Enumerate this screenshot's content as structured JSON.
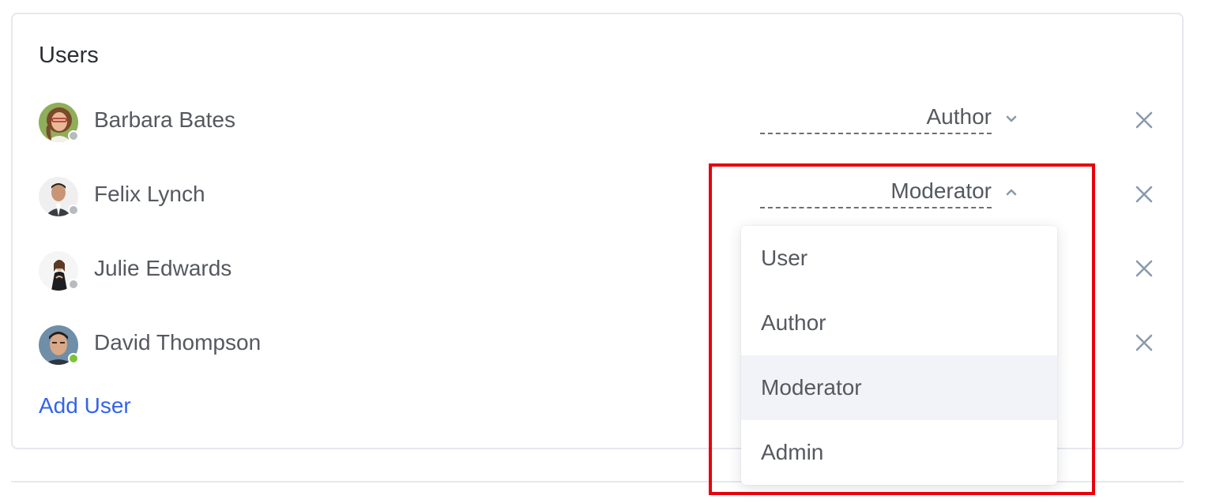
{
  "card": {
    "title": "Users"
  },
  "users": [
    {
      "name": "Barbara Bates",
      "role": "Author",
      "status": "offline",
      "dropdown_open": false
    },
    {
      "name": "Felix Lynch",
      "role": "Moderator",
      "status": "offline",
      "dropdown_open": true
    },
    {
      "name": "Julie Edwards",
      "role": "",
      "status": "offline",
      "dropdown_open": false
    },
    {
      "name": "David Thompson",
      "role": "",
      "status": "online",
      "dropdown_open": false
    }
  ],
  "icons": {
    "chevron_closed": "chevron-down-icon",
    "chevron_open": "chevron-up-icon",
    "remove": "close-icon"
  },
  "dropdown": {
    "options": [
      "User",
      "Author",
      "Moderator",
      "Admin"
    ],
    "selected": "Moderator"
  },
  "add_user_label": "Add User",
  "colors": {
    "accent": "#3563e9",
    "highlight": "#e8000b",
    "online": "#7bc33b",
    "offline": "#b7babf",
    "selected_bg": "#f2f3f8"
  }
}
